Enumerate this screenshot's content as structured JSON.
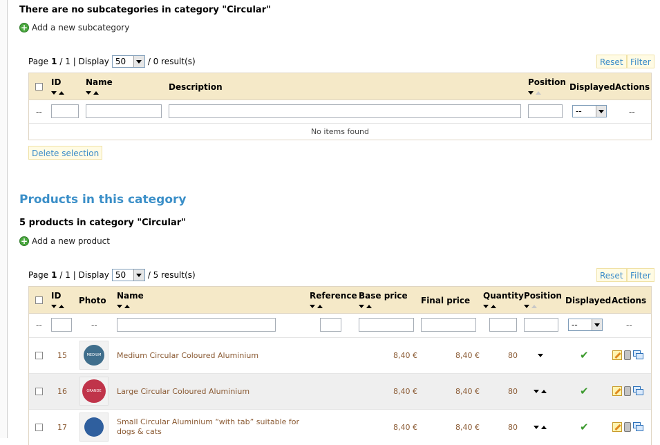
{
  "subcategories": {
    "heading": "There are no subcategories in category \"Circular\"",
    "add_label": "Add a new subcategory",
    "pager": {
      "page_label": "Page",
      "page": "1",
      "sep": "/ 1 | Display",
      "per_page": "50",
      "results": "/ 0 result(s)"
    },
    "reset_label": "Reset",
    "filter_label": "Filter",
    "columns": {
      "id": "ID",
      "name": "Name",
      "description": "Description",
      "position": "Position",
      "displayed": "Displayed",
      "actions": "Actions"
    },
    "filter_dash": "--",
    "displayed_select": "--",
    "empty_text": "No items found",
    "delete_label": "Delete selection"
  },
  "products": {
    "section_title": "Products in this category",
    "heading": "5 products in category \"Circular\"",
    "add_label": "Add a new product",
    "pager": {
      "page_label": "Page",
      "page": "1",
      "sep": "/ 1 | Display",
      "per_page": "50",
      "results": "/ 5 result(s)"
    },
    "reset_label": "Reset",
    "filter_label": "Filter",
    "columns": {
      "id": "ID",
      "photo": "Photo",
      "name": "Name",
      "reference": "Reference",
      "base_price": "Base price",
      "final_price": "Final price",
      "quantity": "Quantity",
      "position": "Position",
      "displayed": "Displayed",
      "actions": "Actions"
    },
    "filter_dash": "--",
    "displayed_select": "--",
    "rows": [
      {
        "id": "15",
        "name": "Medium Circular Coloured Aluminium",
        "base_price": "8,40 €",
        "final_price": "8,40 €",
        "quantity": "80",
        "photo_color": "#3f6e8c",
        "photo_text": "MEDIUM",
        "icons": [
          "edit-icon",
          "delete-icon",
          "duplicate-icon"
        ]
      },
      {
        "id": "16",
        "name": "Large Circular Coloured Aluminium",
        "base_price": "8,40 €",
        "final_price": "8,40 €",
        "quantity": "80",
        "photo_color": "#c0344a",
        "photo_text": "GRANDE",
        "icons": [
          "edit-icon",
          "delete-icon",
          "duplicate-icon"
        ]
      },
      {
        "id": "17",
        "name": "Small Circular Aluminium “with tab” suitable for dogs & cats",
        "base_price": "8,40 €",
        "final_price": "8,40 €",
        "quantity": "80",
        "photo_color": "#2f5f9e",
        "photo_text": "",
        "icons": [
          "edit-icon",
          "delete-icon",
          "duplicate-icon"
        ]
      }
    ]
  },
  "colors": {
    "link_blue": "#3b8fc8",
    "header_bg": "#f5e9c8",
    "product_text": "#8a5a33",
    "check_green": "#3c9a2e"
  }
}
